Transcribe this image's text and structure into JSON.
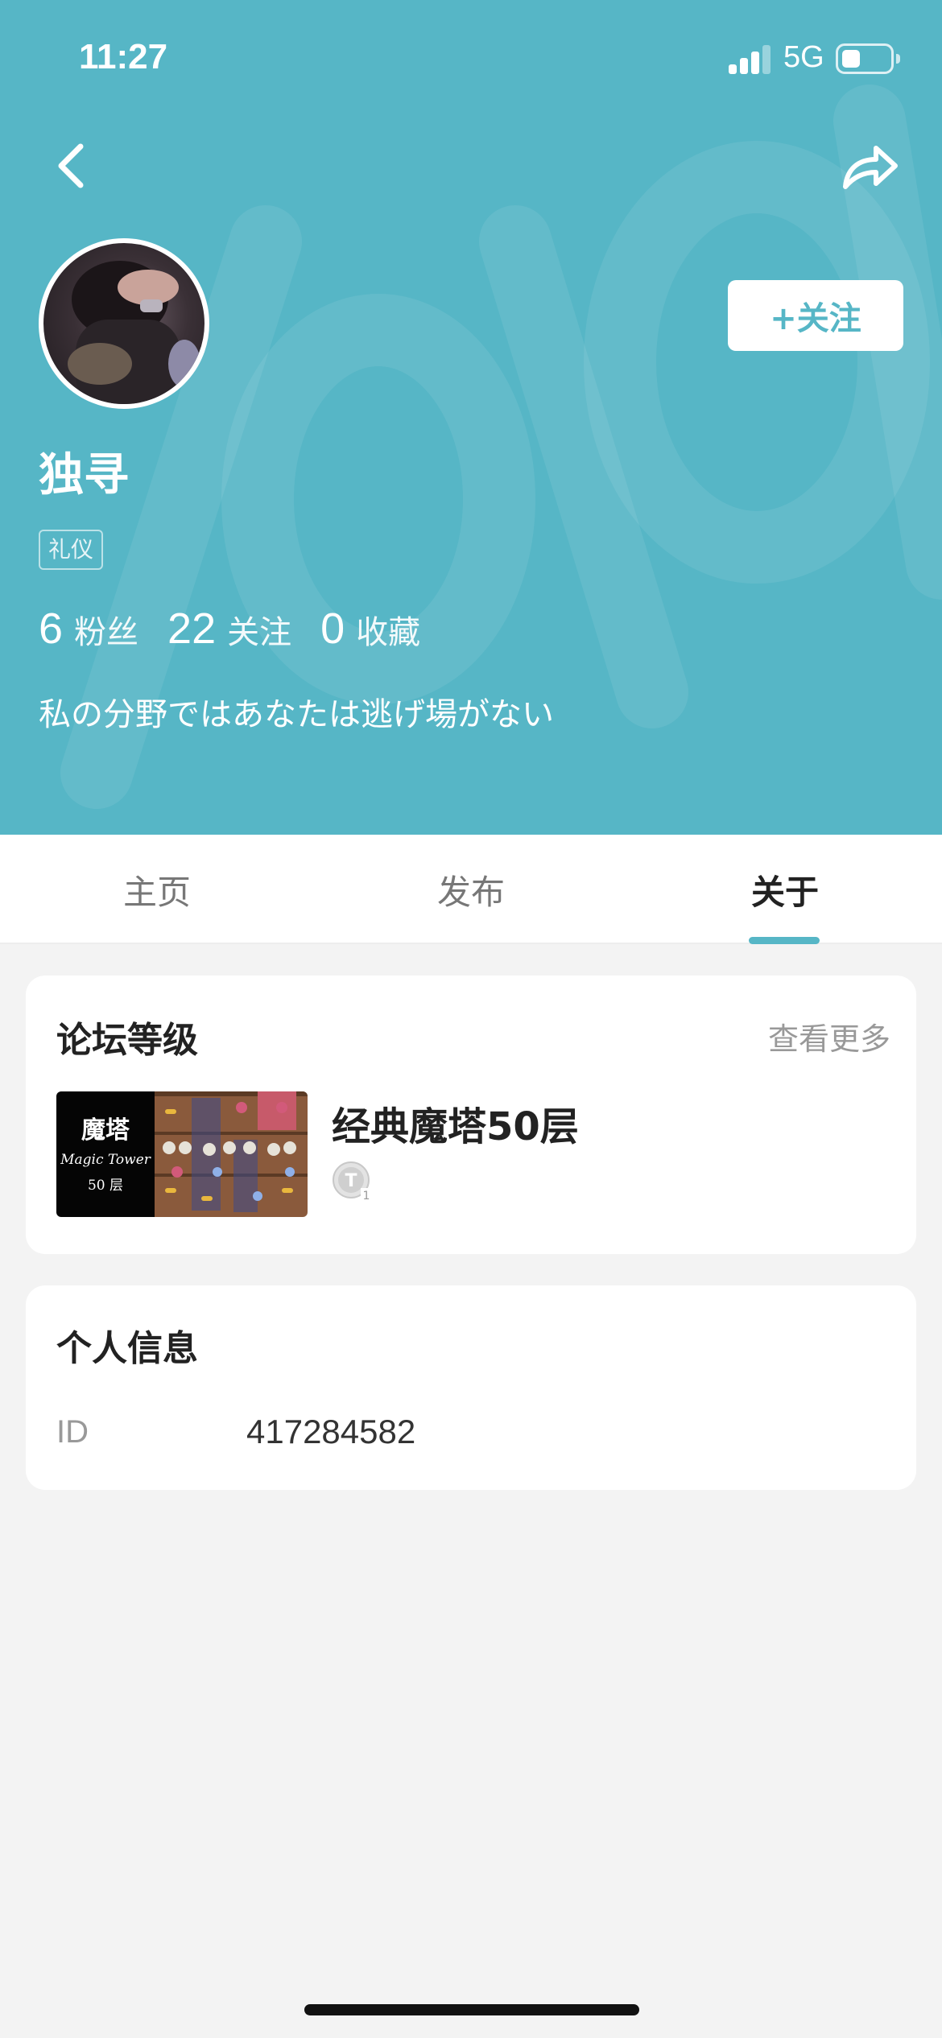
{
  "status_bar": {
    "time": "11:27",
    "network": "5G",
    "signal_bars_active": 3,
    "battery_level": 0.4
  },
  "header": {
    "background_color": "#56b6c6",
    "back_icon": "chevron-left-icon",
    "share_icon": "share-arrow-icon",
    "follow_label": "+关注",
    "username": "独寻",
    "tag": "礼仪",
    "stats": [
      {
        "value": "6",
        "label": "粉丝"
      },
      {
        "value": "22",
        "label": "关注"
      },
      {
        "value": "0",
        "label": "收藏"
      }
    ],
    "bio": "私の分野ではあなたは逃げ場がない"
  },
  "tabs": {
    "items": [
      {
        "label": "主页",
        "active": false
      },
      {
        "label": "发布",
        "active": false
      },
      {
        "label": "关于",
        "active": true
      }
    ],
    "accent_color": "#56b6c6"
  },
  "forum_level": {
    "title": "论坛等级",
    "more_label": "查看更多",
    "game": {
      "name": "经典魔塔50层",
      "thumb_title": "魔塔",
      "thumb_subtitle": "Magic Tower",
      "thumb_floor": "50 层",
      "badge_icon": "level-badge-icon",
      "badge_text": "T",
      "badge_level": "1"
    }
  },
  "personal_info": {
    "title": "个人信息",
    "rows": [
      {
        "label": "ID",
        "value": "417284582"
      }
    ]
  }
}
